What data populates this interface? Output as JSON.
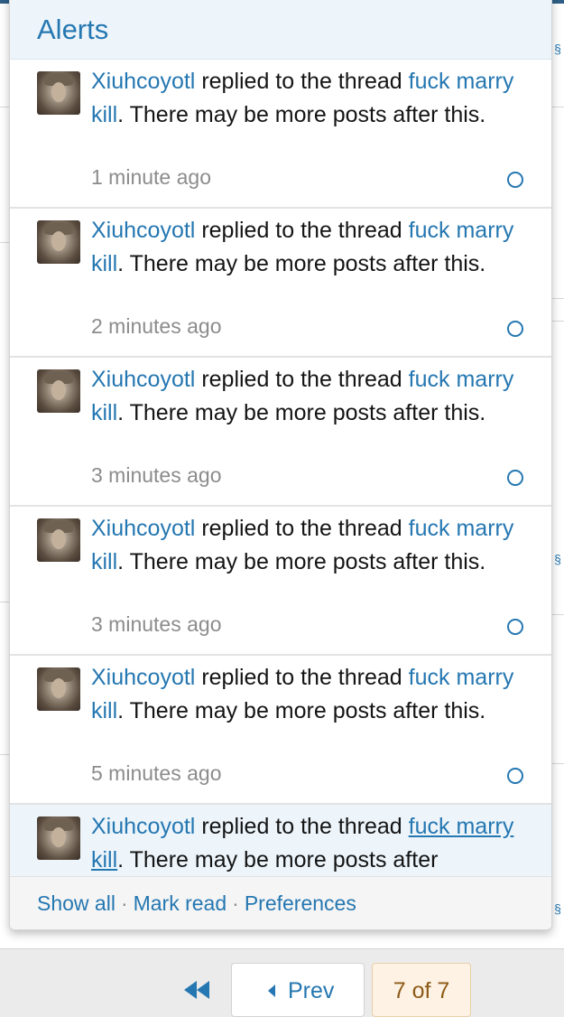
{
  "alerts_popup": {
    "title": "Alerts",
    "items": [
      {
        "username": "Xiuhcoyotl",
        "action": "replied to the thread",
        "thread": "fuck marry kill",
        "thread_line1": "fuck",
        "thread_line2": "marry kill",
        "suffix": ". There may be more posts after this.",
        "time": "1 minute ago"
      },
      {
        "username": "Xiuhcoyotl",
        "action": "replied to the thread",
        "thread": "fuck marry kill",
        "thread_line1": "fuck",
        "thread_line2": "marry kill",
        "suffix": ". There may be more posts after this.",
        "time": "2 minutes ago"
      },
      {
        "username": "Xiuhcoyotl",
        "action": "replied to the thread",
        "thread": "fuck marry kill",
        "thread_line1": "fuck",
        "thread_line2": "marry kill",
        "suffix": ". There may be more posts after this.",
        "time": "3 minutes ago"
      },
      {
        "username": "Xiuhcoyotl",
        "action": "replied to the thread",
        "thread": "fuck marry kill",
        "thread_line1": "fuck",
        "thread_line2": "marry kill",
        "suffix": ". There may be more posts after this.",
        "time": "3 minutes ago"
      },
      {
        "username": "Xiuhcoyotl",
        "action": "replied to the thread",
        "thread": "fuck marry kill",
        "thread_line1": "fuck",
        "thread_line2": "marry kill",
        "suffix": ". There may be more posts after this.",
        "time": "5 minutes ago"
      },
      {
        "username": "Xiuhcoyotl",
        "action": "replied to the thread",
        "thread": "fuck marry kill",
        "thread_line1": "fuck",
        "thread_line2": "marry kill",
        "suffix": ". There may be more posts after",
        "unread": true
      }
    ],
    "footer": {
      "show_all": "Show all",
      "mark_read": "Mark read",
      "preferences": "Preferences",
      "separator": "·"
    }
  },
  "pagination": {
    "prev_label": "Prev",
    "page_label": "7 of 7"
  },
  "icons": {
    "first_page": "double-left-arrow-icon",
    "prev": "left-triangle-icon",
    "read_marker": "circle-outline-icon",
    "edge": "squiggle-icon"
  },
  "colors": {
    "link": "#2577b1",
    "header_bg": "#edf5fb",
    "current_page_bg": "#fdf2e3"
  }
}
